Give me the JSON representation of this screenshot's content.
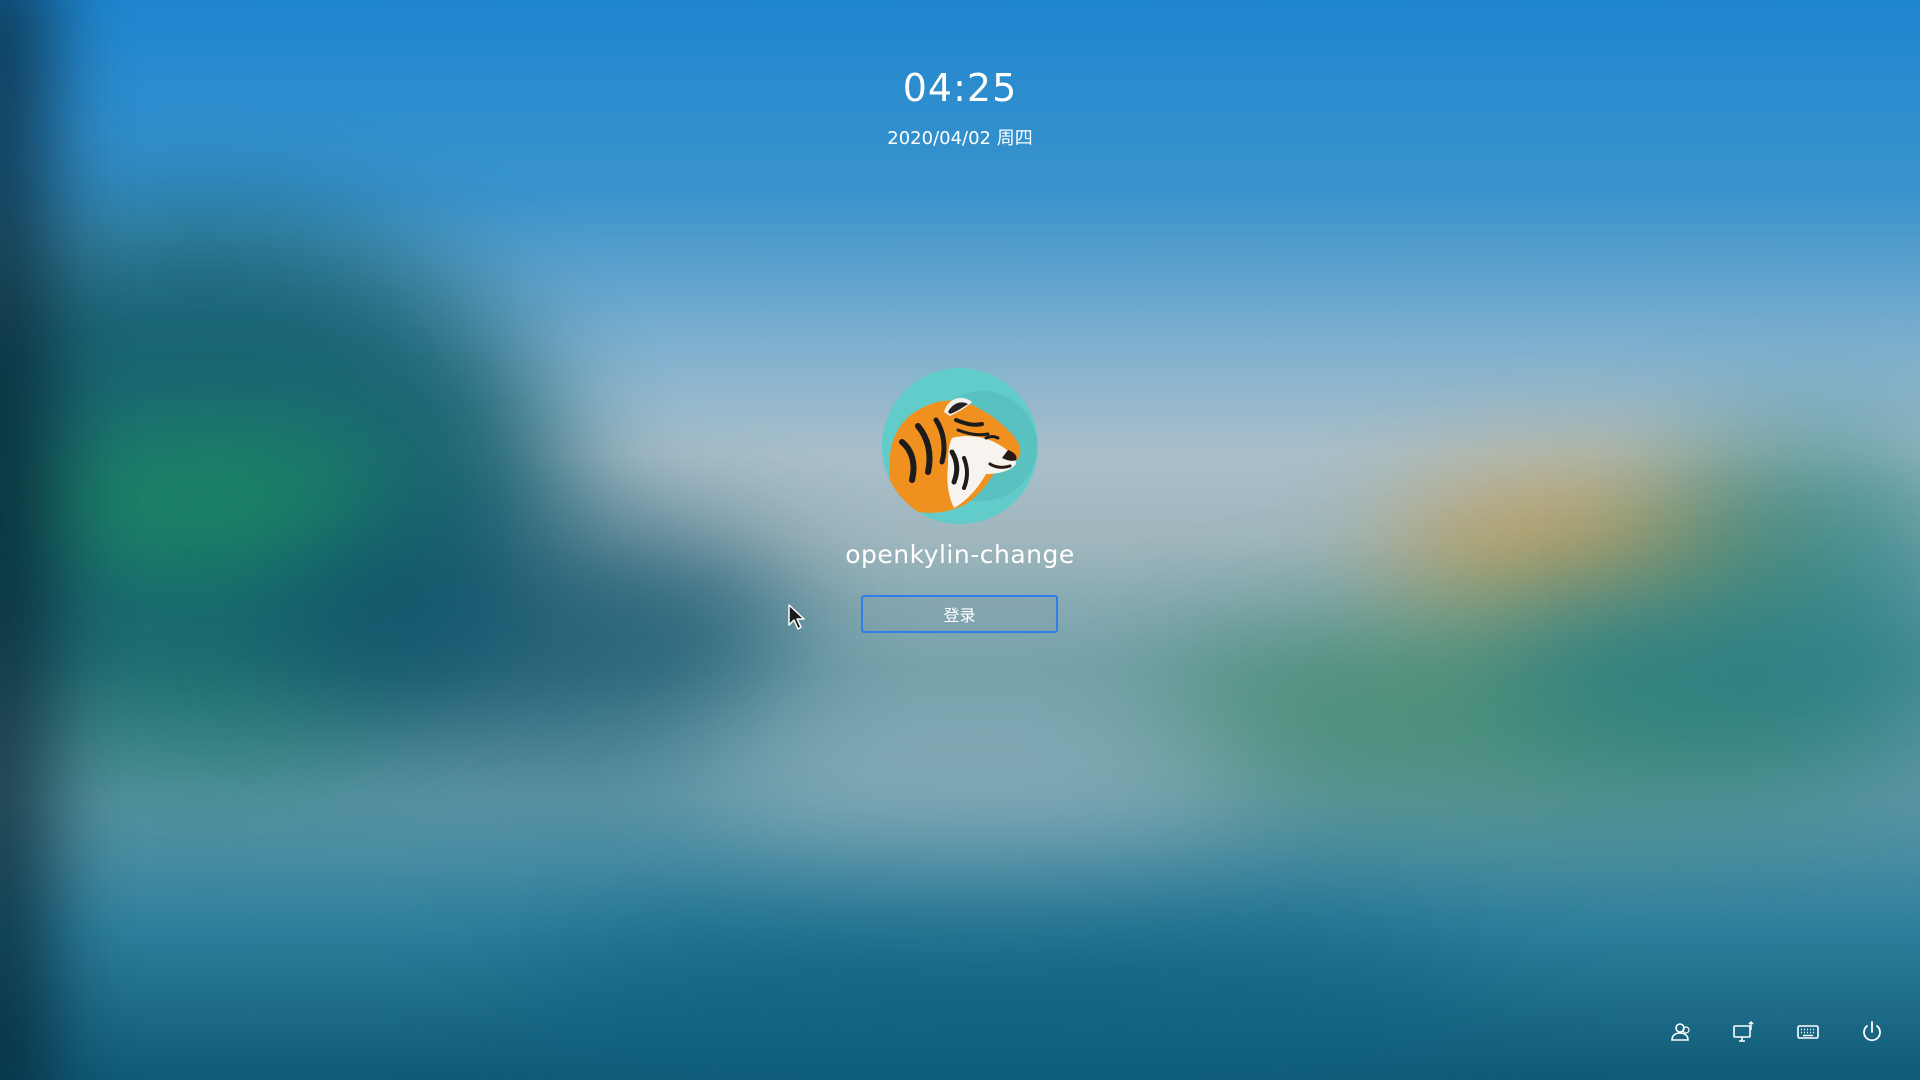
{
  "lockscreen": {
    "time": "04:25",
    "date": "2020/04/02 周四"
  },
  "user": {
    "name": "openkylin-change",
    "avatar_icon": "tiger-avatar-icon"
  },
  "login_button": {
    "label": "登录",
    "border_color": "#2f7fe6"
  },
  "tray": {
    "icons": [
      "switch-user-icon",
      "network-icon",
      "keyboard-icon",
      "power-icon"
    ]
  }
}
